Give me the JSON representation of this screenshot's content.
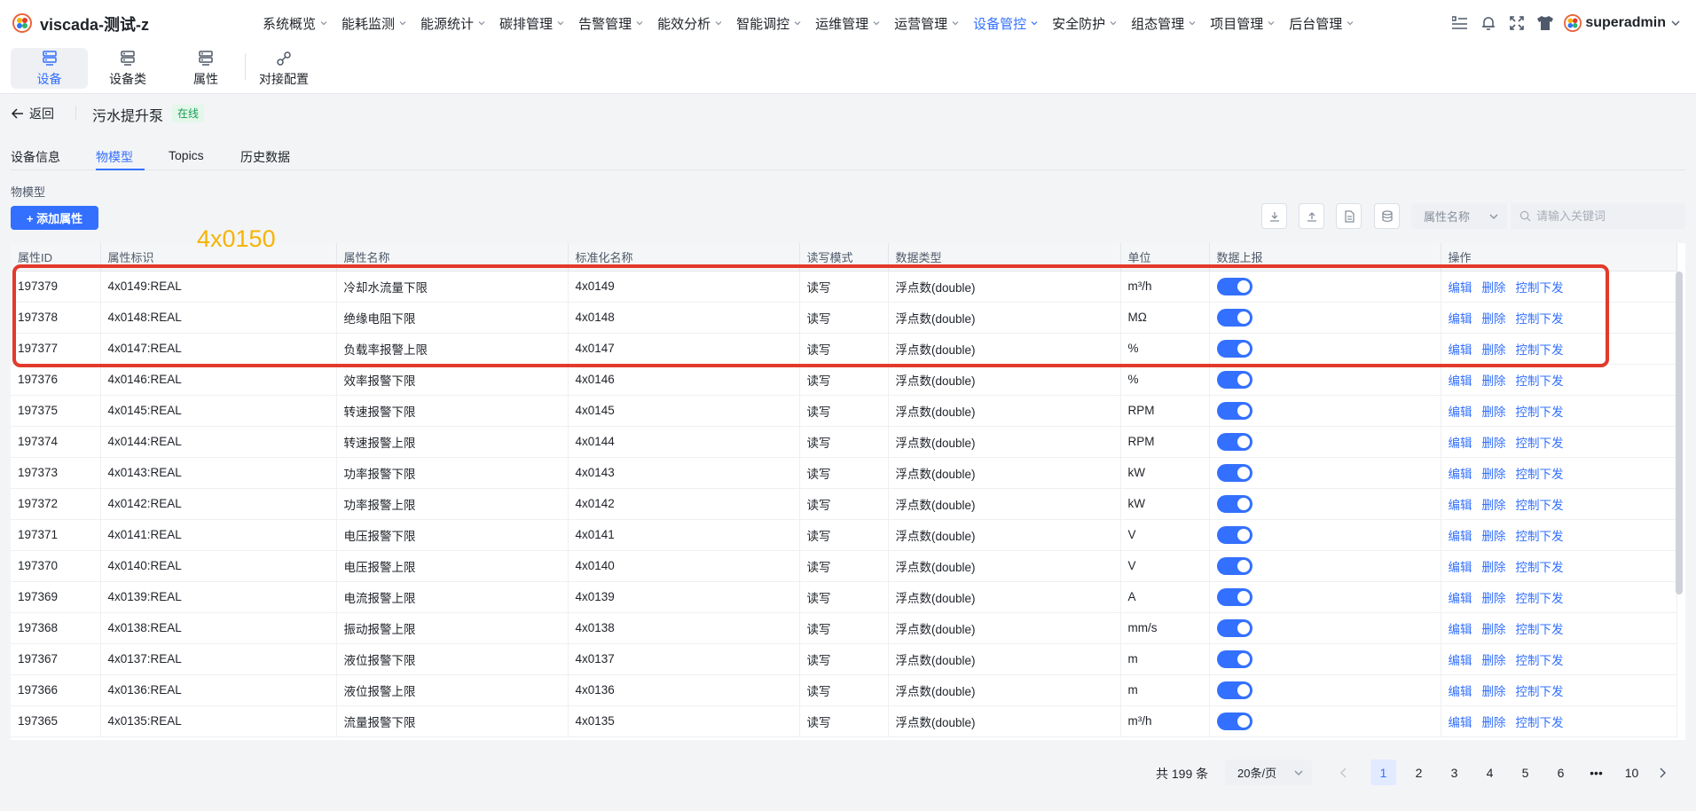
{
  "app": {
    "title": "viscada-测试-z",
    "user": "superadmin"
  },
  "nav": [
    {
      "label": "系统概览",
      "active": false
    },
    {
      "label": "能耗监测",
      "active": false
    },
    {
      "label": "能源统计",
      "active": false
    },
    {
      "label": "碳排管理",
      "active": false
    },
    {
      "label": "告警管理",
      "active": false
    },
    {
      "label": "能效分析",
      "active": false
    },
    {
      "label": "智能调控",
      "active": false
    },
    {
      "label": "运维管理",
      "active": false
    },
    {
      "label": "运营管理",
      "active": false
    },
    {
      "label": "设备管控",
      "active": true
    },
    {
      "label": "安全防护",
      "active": false
    },
    {
      "label": "组态管理",
      "active": false
    },
    {
      "label": "项目管理",
      "active": false
    },
    {
      "label": "后台管理",
      "active": false
    }
  ],
  "subbar": {
    "device": "设备",
    "device_class": "设备类",
    "attribute": "属性",
    "integration": "对接配置"
  },
  "header": {
    "back": "返回",
    "device_name": "污水提升泵",
    "status": "在线"
  },
  "tabs": {
    "info": "设备信息",
    "model": "物模型",
    "topics": "Topics",
    "history": "历史数据"
  },
  "section_label": "物模型",
  "add_button": "+ 添加属性",
  "search": {
    "field": "属性名称",
    "placeholder": "请输入关键词"
  },
  "annotation": "4x0150",
  "columns": {
    "id": "属性ID",
    "key": "属性标识",
    "name": "属性名称",
    "std": "标准化名称",
    "rw": "读写模式",
    "type": "数据类型",
    "unit": "单位",
    "report": "数据上报",
    "ops": "操作"
  },
  "ops": {
    "edit": "编辑",
    "delete": "删除",
    "control": "控制下发"
  },
  "rows": [
    {
      "id": "197379",
      "key": "4x0149:REAL",
      "name": "冷却水流量下限",
      "std": "4x0149",
      "rw": "读写",
      "type": "浮点数(double)",
      "unit": "m³/h"
    },
    {
      "id": "197378",
      "key": "4x0148:REAL",
      "name": "绝缘电阻下限",
      "std": "4x0148",
      "rw": "读写",
      "type": "浮点数(double)",
      "unit": "MΩ"
    },
    {
      "id": "197377",
      "key": "4x0147:REAL",
      "name": "负载率报警上限",
      "std": "4x0147",
      "rw": "读写",
      "type": "浮点数(double)",
      "unit": "%"
    },
    {
      "id": "197376",
      "key": "4x0146:REAL",
      "name": "效率报警下限",
      "std": "4x0146",
      "rw": "读写",
      "type": "浮点数(double)",
      "unit": "%"
    },
    {
      "id": "197375",
      "key": "4x0145:REAL",
      "name": "转速报警下限",
      "std": "4x0145",
      "rw": "读写",
      "type": "浮点数(double)",
      "unit": "RPM"
    },
    {
      "id": "197374",
      "key": "4x0144:REAL",
      "name": "转速报警上限",
      "std": "4x0144",
      "rw": "读写",
      "type": "浮点数(double)",
      "unit": "RPM"
    },
    {
      "id": "197373",
      "key": "4x0143:REAL",
      "name": "功率报警下限",
      "std": "4x0143",
      "rw": "读写",
      "type": "浮点数(double)",
      "unit": "kW"
    },
    {
      "id": "197372",
      "key": "4x0142:REAL",
      "name": "功率报警上限",
      "std": "4x0142",
      "rw": "读写",
      "type": "浮点数(double)",
      "unit": "kW"
    },
    {
      "id": "197371",
      "key": "4x0141:REAL",
      "name": "电压报警下限",
      "std": "4x0141",
      "rw": "读写",
      "type": "浮点数(double)",
      "unit": "V"
    },
    {
      "id": "197370",
      "key": "4x0140:REAL",
      "name": "电压报警上限",
      "std": "4x0140",
      "rw": "读写",
      "type": "浮点数(double)",
      "unit": "V"
    },
    {
      "id": "197369",
      "key": "4x0139:REAL",
      "name": "电流报警上限",
      "std": "4x0139",
      "rw": "读写",
      "type": "浮点数(double)",
      "unit": "A"
    },
    {
      "id": "197368",
      "key": "4x0138:REAL",
      "name": "振动报警上限",
      "std": "4x0138",
      "rw": "读写",
      "type": "浮点数(double)",
      "unit": "mm/s"
    },
    {
      "id": "197367",
      "key": "4x0137:REAL",
      "name": "液位报警下限",
      "std": "4x0137",
      "rw": "读写",
      "type": "浮点数(double)",
      "unit": "m"
    },
    {
      "id": "197366",
      "key": "4x0136:REAL",
      "name": "液位报警上限",
      "std": "4x0136",
      "rw": "读写",
      "type": "浮点数(double)",
      "unit": "m"
    },
    {
      "id": "197365",
      "key": "4x0135:REAL",
      "name": "流量报警下限",
      "std": "4x0135",
      "rw": "读写",
      "type": "浮点数(double)",
      "unit": "m³/h"
    }
  ],
  "pagination": {
    "total": "共 199 条",
    "page_size": "20条/页",
    "pages": [
      "1",
      "2",
      "3",
      "4",
      "5",
      "6",
      "•••",
      "10"
    ],
    "current": "1"
  },
  "colors": {
    "accent": "#3370ff",
    "highlight": "#e23a2b",
    "annotation": "#f5b400",
    "online": "#1a9e55"
  }
}
